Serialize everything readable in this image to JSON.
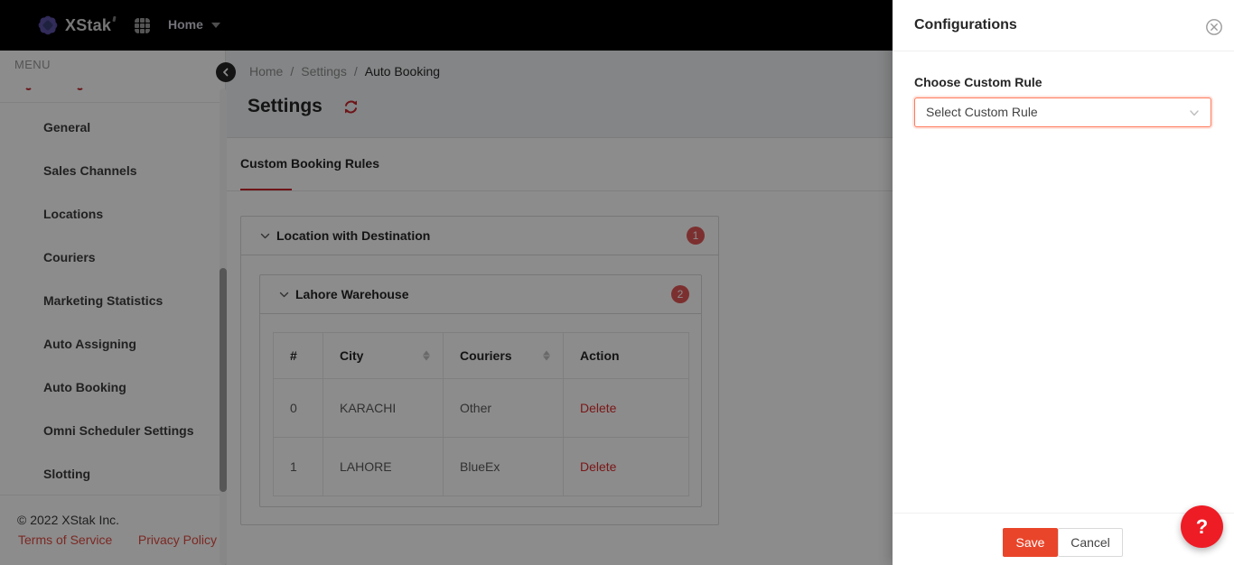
{
  "header": {
    "brand": "XStak",
    "nav_home": "Home"
  },
  "sidebar": {
    "menu_label": "MENU",
    "items": [
      "General",
      "Sales Channels",
      "Locations",
      "Couriers",
      "Marketing Statistics",
      "Auto Assigning",
      "Auto Booking",
      "Omni Scheduler Settings",
      "Slotting"
    ],
    "copyright": "© 2022 XStak Inc.",
    "links": [
      "Terms of Service",
      "Privacy Policy"
    ]
  },
  "breadcrumb": {
    "separator": "/",
    "items": [
      "Home",
      "Settings",
      "Auto Booking"
    ]
  },
  "page": {
    "title": "Settings",
    "tab": "Custom Booking Rules"
  },
  "panels": {
    "outer": {
      "title": "Location with Destination",
      "badge": "1"
    },
    "inner": {
      "title": "Lahore Warehouse",
      "badge": "2"
    }
  },
  "table": {
    "columns": [
      "#",
      "City",
      "Couriers",
      "Action"
    ],
    "rows": [
      {
        "index": "0",
        "city": "KARACHI",
        "courier": "Other",
        "action": "Delete"
      },
      {
        "index": "1",
        "city": "LAHORE",
        "courier": "BlueEx",
        "action": "Delete"
      }
    ]
  },
  "drawer": {
    "title": "Configurations",
    "field_label": "Choose Custom Rule",
    "select_placeholder": "Select Custom Rule",
    "save": "Save",
    "cancel": "Cancel",
    "help": "?"
  },
  "colors": {
    "header_bg": "#000000",
    "logo_purple": "#5b51a6",
    "accent_red": "#c9252d",
    "delete_red": "#e02a2a",
    "badge_red": "#e25757",
    "save_red": "#e9452a",
    "help_red": "#ee1c25",
    "select_border": "#ff7a5c",
    "mask": "rgba(0,0,0,0.45)"
  }
}
